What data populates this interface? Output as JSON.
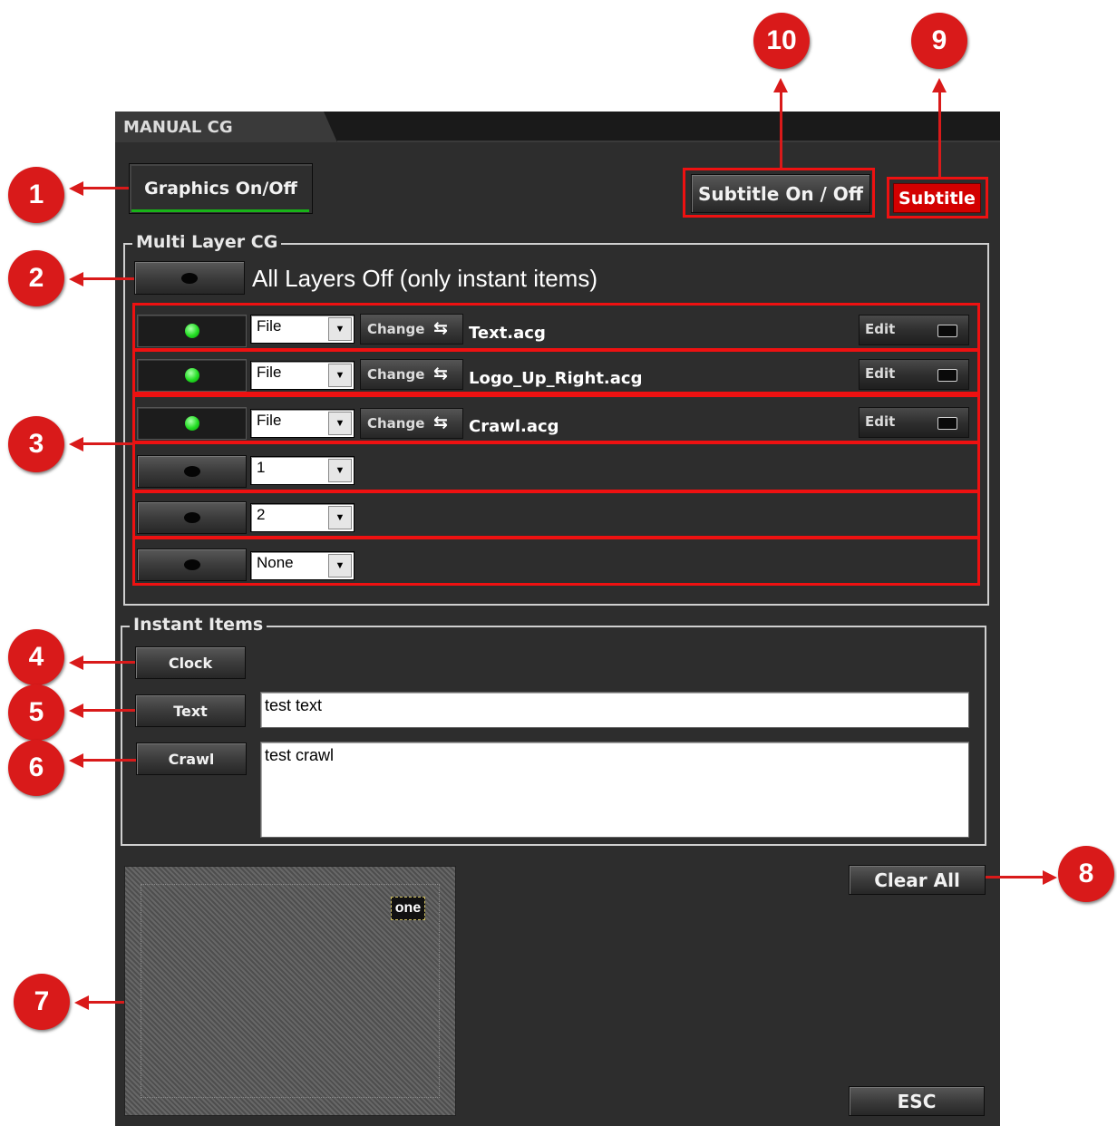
{
  "window": {
    "tab_title": "MANUAL CG"
  },
  "top_controls": {
    "graphics_toggle": "Graphics On/Off",
    "subtitle_toggle": "Subtitle On / Off",
    "subtitle_button": "Subtitle"
  },
  "multi_layer": {
    "title": "Multi Layer CG",
    "all_off_label": "All Layers Off (only instant items)",
    "layers": [
      {
        "active": true,
        "source": "File",
        "change_label": "Change",
        "file": "Text.acg",
        "edit_label": "Edit"
      },
      {
        "active": true,
        "source": "File",
        "change_label": "Change",
        "file": "Logo_Up_Right.acg",
        "edit_label": "Edit"
      },
      {
        "active": true,
        "source": "File",
        "change_label": "Change",
        "file": "Crawl.acg",
        "edit_label": "Edit"
      },
      {
        "active": false,
        "source": "1"
      },
      {
        "active": false,
        "source": "2"
      },
      {
        "active": false,
        "source": "None"
      }
    ]
  },
  "instant_items": {
    "title": "Instant Items",
    "clock_label": "Clock",
    "text_label": "Text",
    "text_value": "test text",
    "crawl_label": "Crawl",
    "crawl_value": "test crawl"
  },
  "preview": {
    "logo_text": "one"
  },
  "bottom": {
    "clear_all": "Clear All",
    "esc": "ESC"
  },
  "callouts": [
    "1",
    "2",
    "3",
    "4",
    "5",
    "6",
    "7",
    "8",
    "9",
    "10"
  ],
  "colors": {
    "accent_red": "#d91a1a",
    "led_green": "#22dd22",
    "subtitle_red": "#d30000"
  }
}
